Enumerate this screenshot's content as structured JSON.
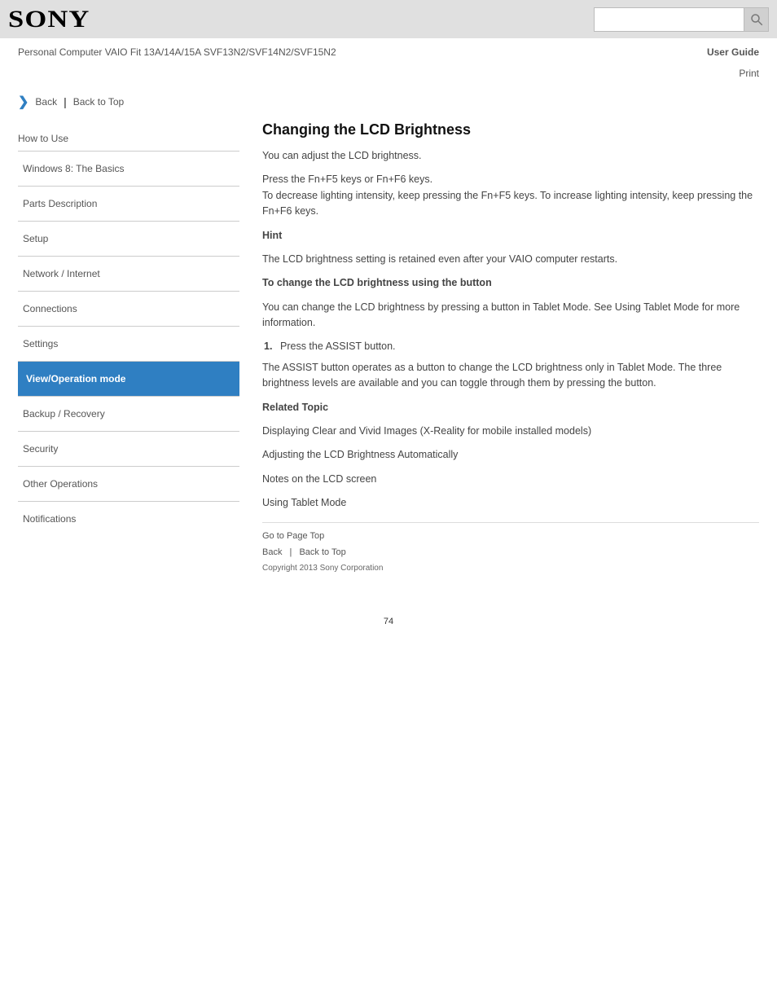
{
  "header": {
    "logo_text": "Sony",
    "search_placeholder": "",
    "search_value": ""
  },
  "subhead": {
    "product": "Personal Computer VAIO Fit 13A/14A/15A SVF13N2/SVF14N2/SVF15N2",
    "manual": "User Guide",
    "print": "Print"
  },
  "breadcrumb": {
    "back": "Back",
    "top": "Back to Top"
  },
  "sidebar": {
    "heading": "How to Use",
    "items": [
      "Windows 8: The Basics",
      "Parts Description",
      "Setup",
      "Network / Internet",
      "Connections",
      "Settings",
      "View/Operation mode",
      "Backup / Recovery",
      "Security",
      "Other Operations",
      "Notifications"
    ],
    "active_index": 6
  },
  "content": {
    "title": "Changing the LCD Brightness",
    "intro": "You can adjust the LCD brightness.",
    "method1": "Press the Fn+F5 keys or Fn+F6 keys.",
    "method1_detail": "To decrease lighting intensity, keep pressing the Fn+F5 keys. To increase lighting intensity, keep pressing the Fn+F6 keys.",
    "hint_label": "Hint",
    "hint_text": "The LCD brightness setting is retained even after your VAIO computer restarts.",
    "method2_head": "To change the LCD brightness using the button",
    "method2_intro": "You can change the LCD brightness by pressing a button in Tablet Mode. See Using Tablet Mode for more information.",
    "step1_num": "1.",
    "step1": "Press the ASSIST button.",
    "step1_detail": "The ASSIST button operates as a button to change the LCD brightness only in Tablet Mode. The three brightness levels are available and you can toggle through them by pressing the button.",
    "related_label": "Related Topic",
    "related_items": [
      "Displaying Clear and Vivid Images (X-Reality for mobile installed models)",
      "Adjusting the LCD Brightness Automatically",
      "Notes on the LCD screen",
      "Using Tablet Mode"
    ]
  },
  "footer": {
    "link1": "Go to Page Top",
    "link2": "Back",
    "link3": "Back to Top",
    "copyright": "Copyright 2013 Sony Corporation"
  },
  "page_number": "74"
}
